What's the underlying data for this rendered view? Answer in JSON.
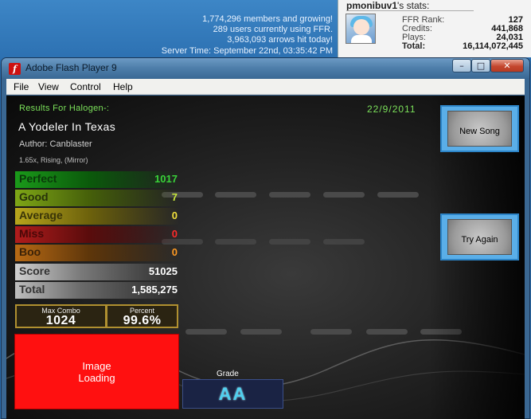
{
  "site": {
    "stats_lines": [
      "1,774,296 members and growing!",
      "289 users currently using FFR.",
      "3,963,093 arrows hit today!",
      "Server Time: September 22nd, 03:35:42 PM"
    ],
    "user": {
      "username": "pmonibuv1",
      "title_suffix": "'s stats:",
      "stats": [
        {
          "label": "FFR Rank:",
          "value": "127"
        },
        {
          "label": "Credits:",
          "value": "441,868"
        },
        {
          "label": "Plays:",
          "value": "24,031"
        },
        {
          "label": "Total:",
          "value": "16,114,072,445"
        }
      ]
    }
  },
  "window": {
    "title": "Adobe Flash Player 9",
    "icon_glyph": "f",
    "controls": {
      "minimize": "–",
      "maximize": "□",
      "close": "✕"
    },
    "menu": [
      "File",
      "View",
      "Control",
      "Help"
    ]
  },
  "results": {
    "header": "Results For Halogen-:",
    "date": "22/9/2011",
    "song_title": "A Yodeler In Texas",
    "author": "Author: Canblaster",
    "mods": "1.65x, Rising, (Mirror)",
    "judgements": [
      {
        "label": "Perfect",
        "value": "1017"
      },
      {
        "label": "Good",
        "value": "7"
      },
      {
        "label": "Average",
        "value": "0"
      },
      {
        "label": "Miss",
        "value": "0"
      },
      {
        "label": "Boo",
        "value": "0"
      }
    ],
    "score_label": "Score",
    "score": "51025",
    "total_label": "Total",
    "total": "1,585,275",
    "max_combo_label": "Max Combo",
    "max_combo": "1024",
    "percent_label": "Percent",
    "percent": "99.6%",
    "image_loading": [
      "Image",
      "Loading"
    ],
    "grade_label": "Grade",
    "grade": "AA",
    "buttons": {
      "new_song": "New Song",
      "try_again": "Try Again"
    }
  },
  "colors": {
    "perfect": "#39d239",
    "good": "#c8e83c",
    "average": "#f2e03c",
    "miss": "#ff2a2a",
    "boo": "#ff9a22",
    "accent_green": "#7be05a",
    "button_blue": "#5aaee8"
  }
}
